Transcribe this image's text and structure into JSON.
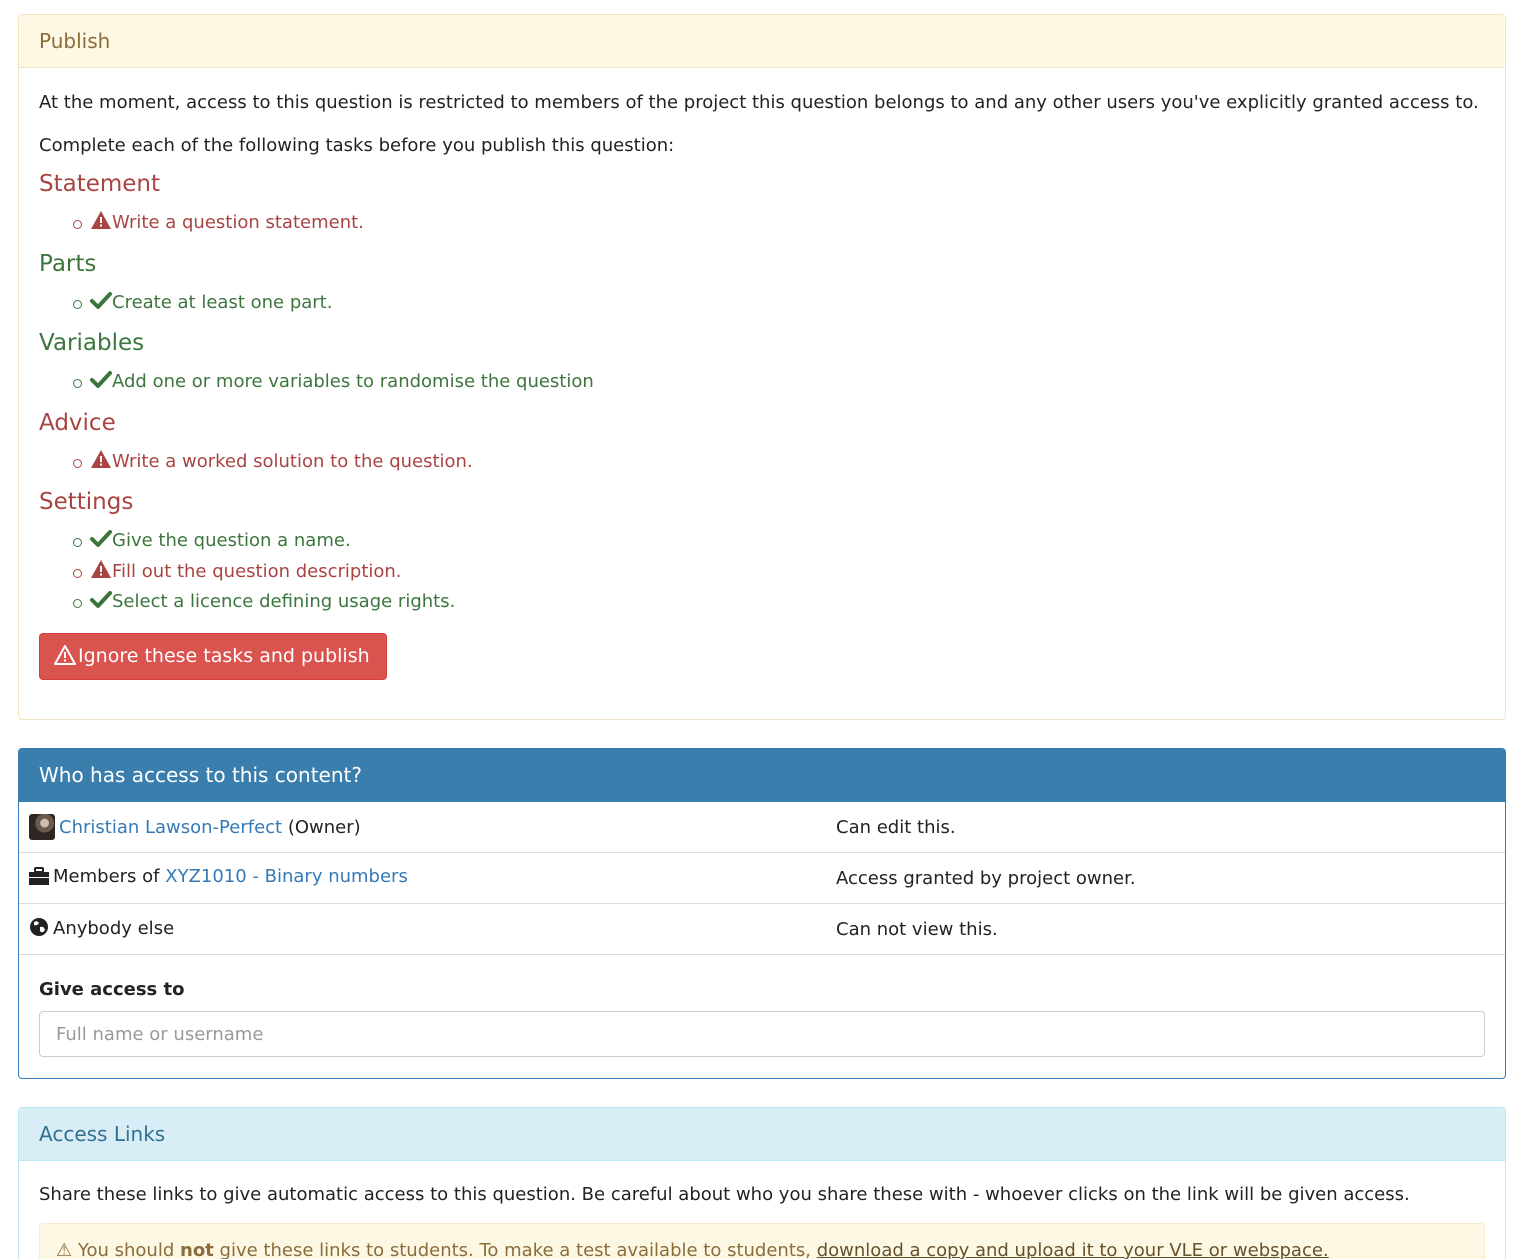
{
  "publish": {
    "heading": "Publish",
    "intro": "At the moment, access to this question is restricted to members of the project this question belongs to and any other users you've explicitly granted access to.",
    "instruction": "Complete each of the following tasks before you publish this question:",
    "groups": [
      {
        "title": "Statement",
        "status": "danger",
        "tasks": [
          {
            "text": "Write a question statement.",
            "done": false,
            "icon": "warning-icon"
          }
        ]
      },
      {
        "title": "Parts",
        "status": "success",
        "tasks": [
          {
            "text": "Create at least one part.",
            "done": true,
            "icon": "check-icon"
          }
        ]
      },
      {
        "title": "Variables",
        "status": "success",
        "tasks": [
          {
            "text": "Add one or more variables to randomise the question",
            "done": true,
            "icon": "check-icon"
          }
        ]
      },
      {
        "title": "Advice",
        "status": "danger",
        "tasks": [
          {
            "text": "Write a worked solution to the question.",
            "done": false,
            "icon": "warning-icon"
          }
        ]
      },
      {
        "title": "Settings",
        "status": "danger",
        "tasks": [
          {
            "text": "Give the question a name.",
            "done": true,
            "icon": "check-icon"
          },
          {
            "text": "Fill out the question description.",
            "done": false,
            "icon": "warning-icon"
          },
          {
            "text": "Select a licence defining usage rights.",
            "done": true,
            "icon": "check-icon"
          }
        ]
      }
    ],
    "ignore_button": "Ignore these tasks and publish"
  },
  "access": {
    "heading": "Who has access to this content?",
    "rows": [
      {
        "name": "Christian Lawson-Perfect",
        "suffix": "(Owner)",
        "permission": "Can edit this.",
        "icon": "avatar"
      },
      {
        "prefix": "Members of",
        "name": "XYZ1010 - Binary numbers",
        "permission": "Access granted by project owner.",
        "icon": "briefcase-icon"
      },
      {
        "name": "Anybody else",
        "permission": "Can not view this.",
        "icon": "globe-icon"
      }
    ],
    "give_access_label": "Give access to",
    "give_access_placeholder": "Full name or username"
  },
  "links": {
    "heading": "Access Links",
    "description": "Share these links to give automatic access to this question. Be careful about who you share these with - whoever clicks on the link will be given access.",
    "alert_pre": "You should",
    "alert_bold": "not",
    "alert_mid": "give these links to students. To make a test available to students,",
    "alert_link": "download a copy and upload it to your VLE or webspace."
  },
  "colors": {
    "danger": "#a94442",
    "success": "#3c763d",
    "primary": "#3a7eae",
    "link": "#337ab7"
  }
}
